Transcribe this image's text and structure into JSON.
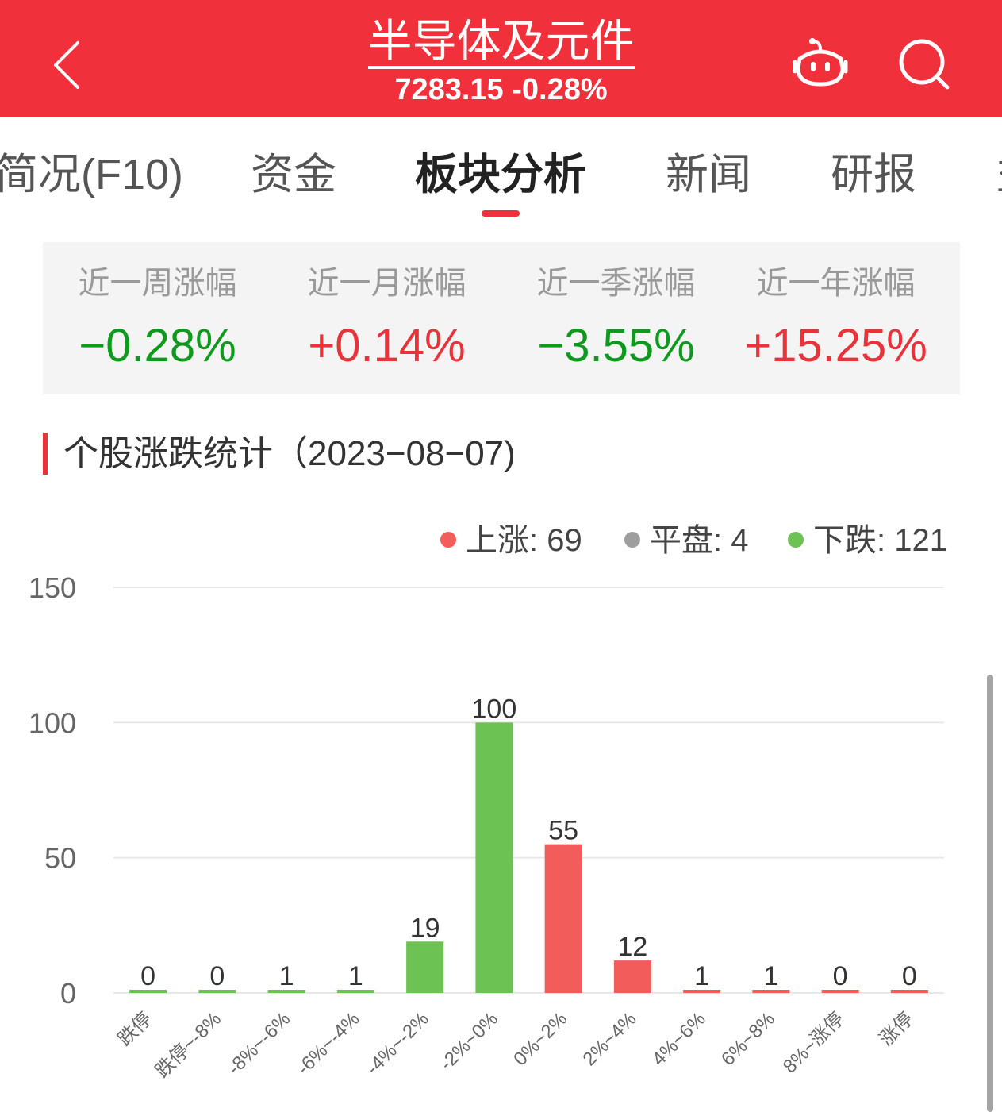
{
  "header": {
    "back_icon": "chevron-left-icon",
    "title": "半导体及元件",
    "subtitle": "7283.15 -0.28%",
    "robot_icon": "robot-assistant-icon",
    "search_icon": "search-icon",
    "color": "#f0303a"
  },
  "tabs": [
    {
      "label": "简况(F10)",
      "active": false
    },
    {
      "label": "资金",
      "active": false
    },
    {
      "label": "板块分析",
      "active": true
    },
    {
      "label": "新闻",
      "active": false
    },
    {
      "label": "研报",
      "active": false
    },
    {
      "label": "益",
      "active": false
    }
  ],
  "performance": [
    {
      "label": "近一周涨幅",
      "value": "−0.28%",
      "direction": "down"
    },
    {
      "label": "近一月涨幅",
      "value": "+0.14%",
      "direction": "up"
    },
    {
      "label": "近一季涨幅",
      "value": "−3.55%",
      "direction": "down"
    },
    {
      "label": "近一年涨幅",
      "value": "+15.25%",
      "direction": "up"
    }
  ],
  "section": {
    "title": "个股涨跌统计（2023−08−07)"
  },
  "legend": [
    {
      "label": "上涨: 69",
      "color": "#f25c5a"
    },
    {
      "label": "平盘: 4",
      "color": "#9e9e9e"
    },
    {
      "label": "下跌: 121",
      "color": "#6cc353"
    }
  ],
  "colors": {
    "up": "#f25c5a",
    "down": "#6cc353",
    "up_text": "#e8333b",
    "down_text": "#0f9a1e"
  },
  "chart_data": {
    "type": "bar",
    "title": "个股涨跌统计（2023−08−07)",
    "xlabel": "",
    "ylabel": "",
    "categories": [
      "跌停",
      "跌停~-8%",
      "-8%~-6%",
      "-6%~-4%",
      "-4%~-2%",
      "-2%~0%",
      "0%~2%",
      "2%~4%",
      "4%~6%",
      "6%~8%",
      "8%~涨停",
      "涨停"
    ],
    "values": [
      0,
      0,
      1,
      1,
      19,
      100,
      55,
      12,
      1,
      1,
      0,
      0
    ],
    "bar_colors": [
      "down",
      "down",
      "down",
      "down",
      "down",
      "down",
      "up",
      "up",
      "up",
      "up",
      "up",
      "up"
    ],
    "ylim": [
      0,
      150
    ],
    "yticks": [
      0,
      50,
      100,
      150
    ],
    "grid": true,
    "legend_position": "top-right",
    "legend": [
      "上涨: 69",
      "平盘: 4",
      "下跌: 121"
    ]
  }
}
